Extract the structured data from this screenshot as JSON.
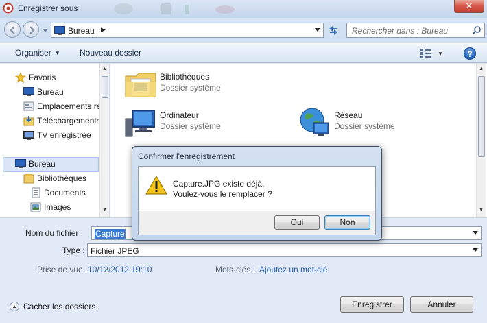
{
  "window": {
    "title": "Enregistrer sous",
    "close_glyph": "✕"
  },
  "address": {
    "crumb": "Bureau",
    "crumb_arrow": "▶"
  },
  "search": {
    "placeholder": "Rechercher dans : Bureau"
  },
  "toolbar": {
    "organize": "Organiser",
    "new_folder": "Nouveau dossier",
    "help": "?"
  },
  "nav": {
    "items": [
      {
        "label": "Favoris",
        "icon": "star-icon"
      },
      {
        "label": "Bureau",
        "icon": "desktop-icon"
      },
      {
        "label": "Emplacements ré",
        "icon": "recent-places-icon"
      },
      {
        "label": "Téléchargements",
        "icon": "downloads-icon"
      },
      {
        "label": "TV enregistrée",
        "icon": "tv-icon"
      },
      {
        "label": "Bureau",
        "icon": "desktop-icon"
      },
      {
        "label": "Bibliothèques",
        "icon": "library-icon"
      },
      {
        "label": "Documents",
        "icon": "documents-icon"
      },
      {
        "label": "Images",
        "icon": "pictures-icon"
      }
    ]
  },
  "files": [
    {
      "name": "Bibliothèques",
      "desc": "Dossier système",
      "icon": "libraries-folder-icon"
    },
    {
      "name": "Ordinateur",
      "desc": "Dossier système",
      "icon": "computer-icon"
    },
    {
      "name": "Réseau",
      "desc": "Dossier système",
      "icon": "network-icon"
    }
  ],
  "form": {
    "filename_label": "Nom du fichier :",
    "filename_value": "Capture",
    "type_label": "Type :",
    "type_value": "Fichier JPEG",
    "date_label": "Prise de vue :",
    "date_value": "10/12/2012 19:10",
    "tags_label": "Mots-clés :",
    "tags_value": "Ajoutez un mot-clé",
    "hide_folders": "Cacher les dossiers",
    "save": "Enregistrer",
    "cancel": "Annuler"
  },
  "dialog": {
    "title": "Confirmer l'enregistrement",
    "line1": "Capture.JPG existe déjà.",
    "line2": "Voulez-vous le remplacer ?",
    "yes": "Oui",
    "no": "Non"
  },
  "colors": {
    "accent": "#3a7bd5",
    "link": "#2a5ea8",
    "close": "#c23e2f"
  }
}
